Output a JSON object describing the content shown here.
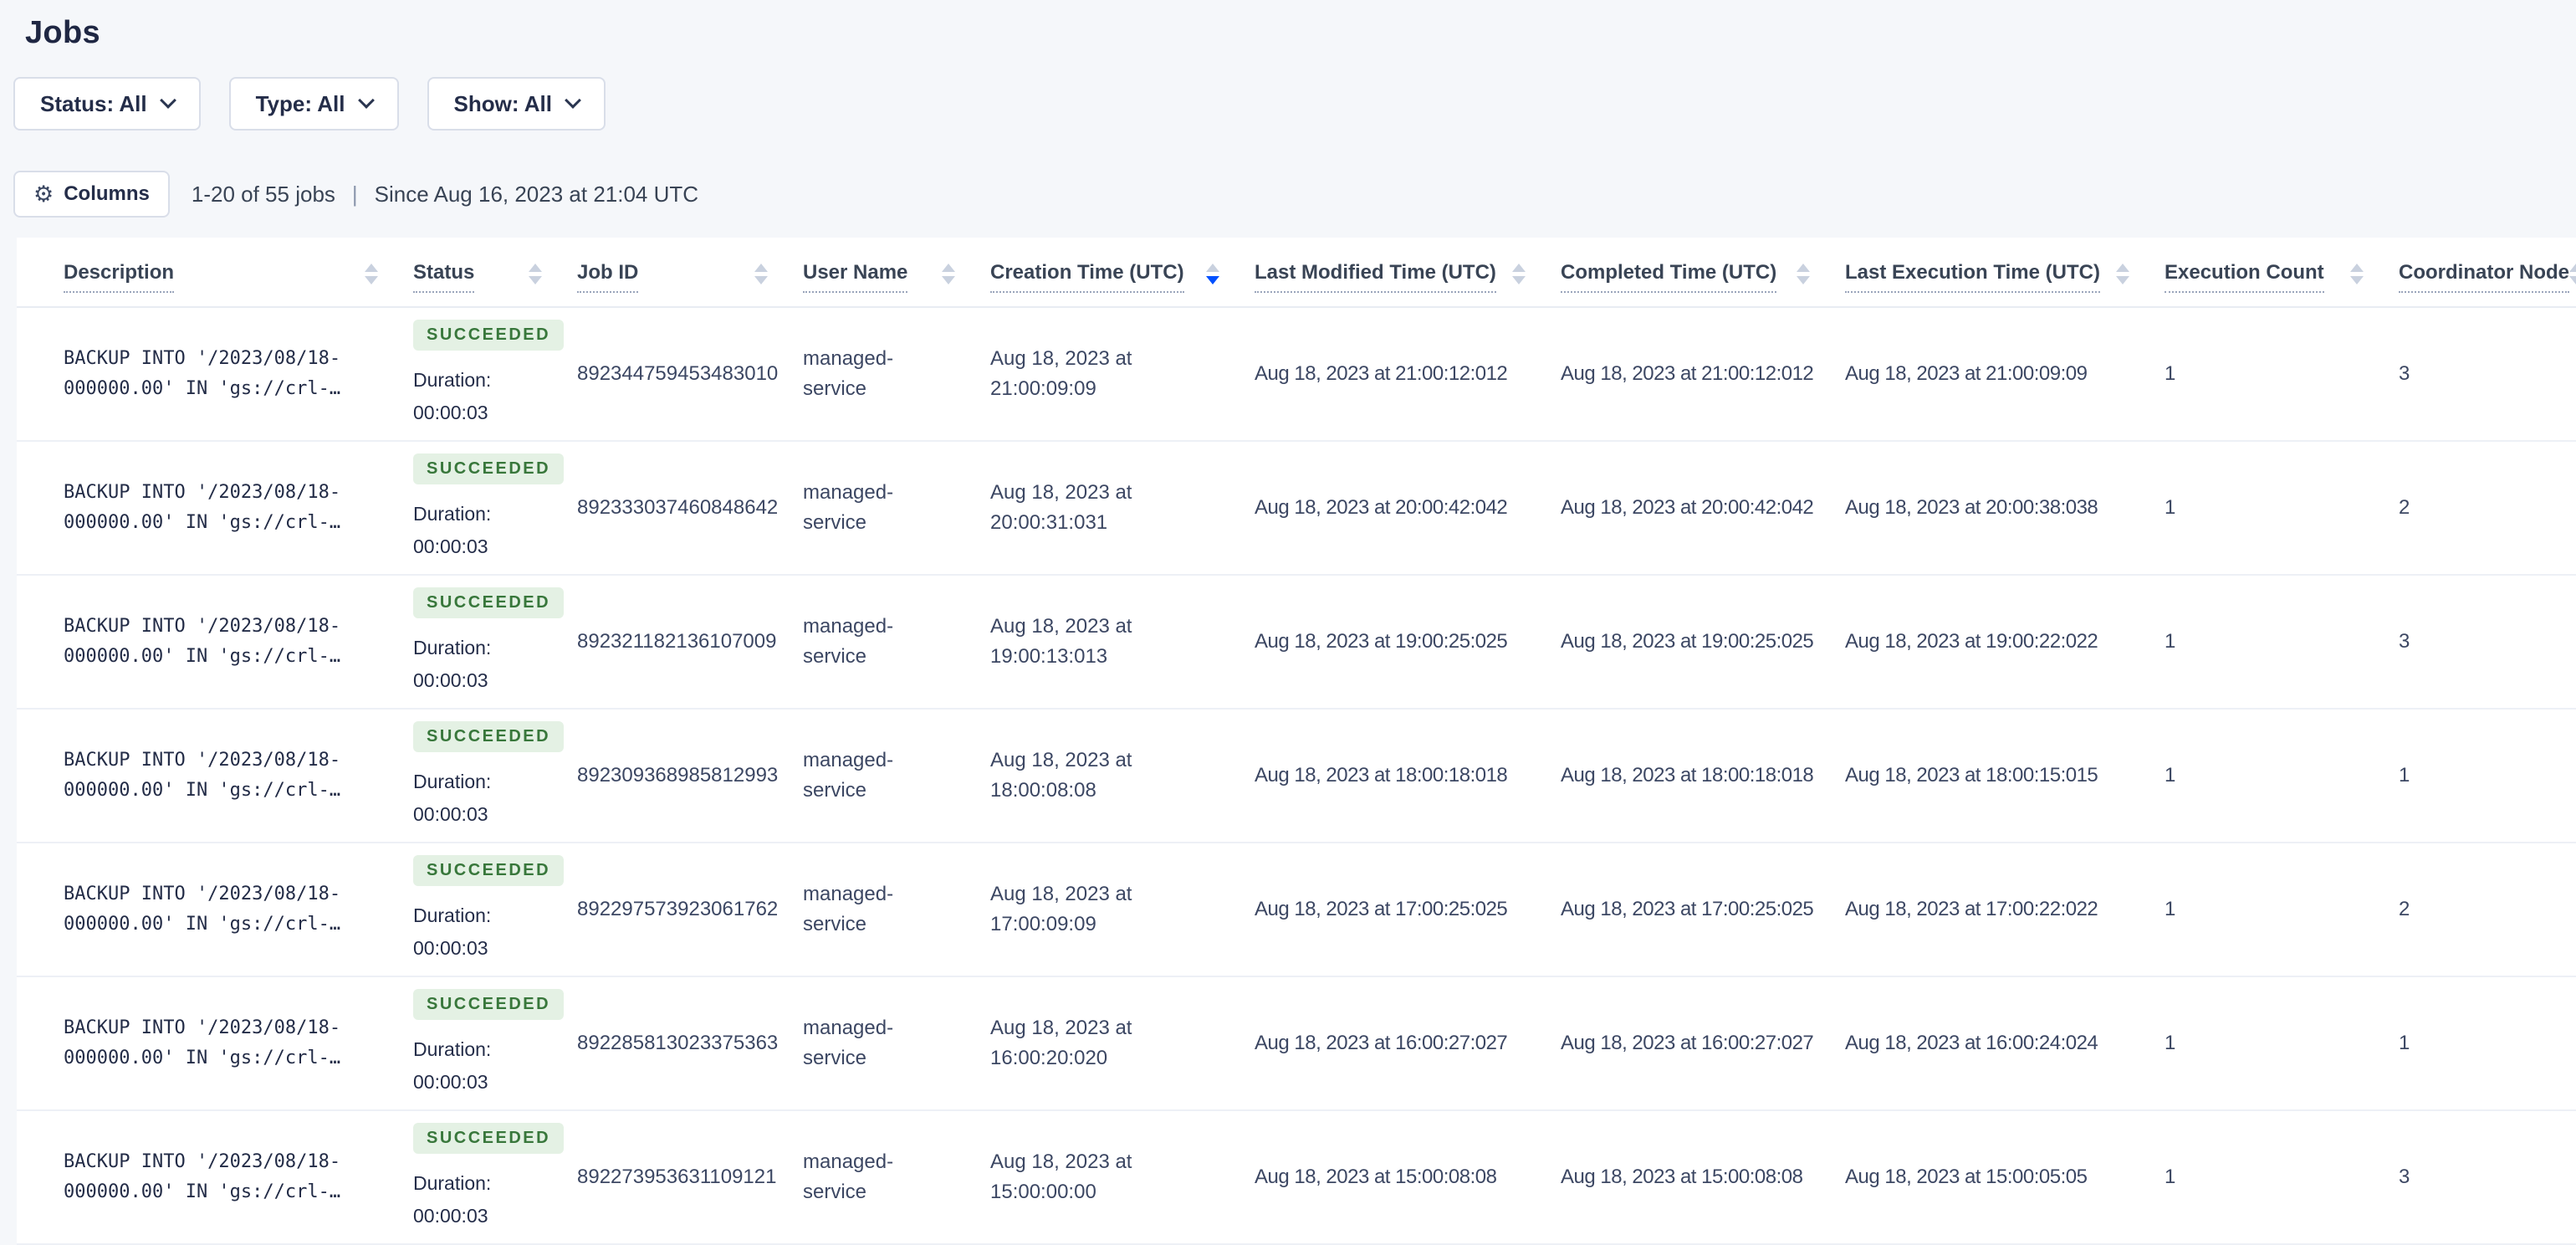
{
  "page": {
    "title": "Jobs"
  },
  "filters": [
    {
      "label": "Status: All"
    },
    {
      "label": "Type: All"
    },
    {
      "label": "Show: All"
    }
  ],
  "toolbar": {
    "columns_label": "Columns",
    "count_text": "1-20 of 55 jobs",
    "separator": "|",
    "since_text": "Since Aug 16, 2023 at 21:04 UTC"
  },
  "colors": {
    "accent_sort_active": "#0050ff",
    "badge_bg": "#e4f1e4",
    "badge_text": "#38773b",
    "page_bg": "#f5f7fa"
  },
  "table": {
    "columns": [
      {
        "label": "Description",
        "sort": "none"
      },
      {
        "label": "Status",
        "sort": "none"
      },
      {
        "label": "Job ID",
        "sort": "none"
      },
      {
        "label": "User Name",
        "sort": "none"
      },
      {
        "label": "Creation Time (UTC)",
        "sort": "desc"
      },
      {
        "label": "Last Modified Time (UTC)",
        "sort": "none"
      },
      {
        "label": "Completed Time (UTC)",
        "sort": "none"
      },
      {
        "label": "Last Execution Time (UTC)",
        "sort": "none"
      },
      {
        "label": "Execution Count",
        "sort": "none"
      },
      {
        "label": "Coordinator Node",
        "sort": "none"
      }
    ],
    "rows": [
      {
        "description_line1": "BACKUP INTO '/2023/08/18-",
        "description_line2": "000000.00' IN 'gs://crl-…",
        "status": "SUCCEEDED",
        "duration_label": "Duration:",
        "duration": "00:00:03",
        "job_id": "892344759453483010",
        "user_name": "managed-service",
        "creation_line1": "Aug 18, 2023 at",
        "creation_line2": "21:00:09:09",
        "last_modified": "Aug 18, 2023 at 21:00:12:012",
        "completed": "Aug 18, 2023 at 21:00:12:012",
        "last_execution": "Aug 18, 2023 at 21:00:09:09",
        "execution_count": "1",
        "coordinator_node": "3"
      },
      {
        "description_line1": "BACKUP INTO '/2023/08/18-",
        "description_line2": "000000.00' IN 'gs://crl-…",
        "status": "SUCCEEDED",
        "duration_label": "Duration:",
        "duration": "00:00:03",
        "job_id": "892333037460848642",
        "user_name": "managed-service",
        "creation_line1": "Aug 18, 2023 at",
        "creation_line2": "20:00:31:031",
        "last_modified": "Aug 18, 2023 at 20:00:42:042",
        "completed": "Aug 18, 2023 at 20:00:42:042",
        "last_execution": "Aug 18, 2023 at 20:00:38:038",
        "execution_count": "1",
        "coordinator_node": "2"
      },
      {
        "description_line1": "BACKUP INTO '/2023/08/18-",
        "description_line2": "000000.00' IN 'gs://crl-…",
        "status": "SUCCEEDED",
        "duration_label": "Duration:",
        "duration": "00:00:03",
        "job_id": "892321182136107009",
        "user_name": "managed-service",
        "creation_line1": "Aug 18, 2023 at",
        "creation_line2": "19:00:13:013",
        "last_modified": "Aug 18, 2023 at 19:00:25:025",
        "completed": "Aug 18, 2023 at 19:00:25:025",
        "last_execution": "Aug 18, 2023 at 19:00:22:022",
        "execution_count": "1",
        "coordinator_node": "3"
      },
      {
        "description_line1": "BACKUP INTO '/2023/08/18-",
        "description_line2": "000000.00' IN 'gs://crl-…",
        "status": "SUCCEEDED",
        "duration_label": "Duration:",
        "duration": "00:00:03",
        "job_id": "892309368985812993",
        "user_name": "managed-service",
        "creation_line1": "Aug 18, 2023 at",
        "creation_line2": "18:00:08:08",
        "last_modified": "Aug 18, 2023 at 18:00:18:018",
        "completed": "Aug 18, 2023 at 18:00:18:018",
        "last_execution": "Aug 18, 2023 at 18:00:15:015",
        "execution_count": "1",
        "coordinator_node": "1"
      },
      {
        "description_line1": "BACKUP INTO '/2023/08/18-",
        "description_line2": "000000.00' IN 'gs://crl-…",
        "status": "SUCCEEDED",
        "duration_label": "Duration:",
        "duration": "00:00:03",
        "job_id": "892297573923061762",
        "user_name": "managed-service",
        "creation_line1": "Aug 18, 2023 at",
        "creation_line2": "17:00:09:09",
        "last_modified": "Aug 18, 2023 at 17:00:25:025",
        "completed": "Aug 18, 2023 at 17:00:25:025",
        "last_execution": "Aug 18, 2023 at 17:00:22:022",
        "execution_count": "1",
        "coordinator_node": "2"
      },
      {
        "description_line1": "BACKUP INTO '/2023/08/18-",
        "description_line2": "000000.00' IN 'gs://crl-…",
        "status": "SUCCEEDED",
        "duration_label": "Duration:",
        "duration": "00:00:03",
        "job_id": "892285813023375363",
        "user_name": "managed-service",
        "creation_line1": "Aug 18, 2023 at",
        "creation_line2": "16:00:20:020",
        "last_modified": "Aug 18, 2023 at 16:00:27:027",
        "completed": "Aug 18, 2023 at 16:00:27:027",
        "last_execution": "Aug 18, 2023 at 16:00:24:024",
        "execution_count": "1",
        "coordinator_node": "1"
      },
      {
        "description_line1": "BACKUP INTO '/2023/08/18-",
        "description_line2": "000000.00' IN 'gs://crl-…",
        "status": "SUCCEEDED",
        "duration_label": "Duration:",
        "duration": "00:00:03",
        "job_id": "892273953631109121",
        "user_name": "managed-service",
        "creation_line1": "Aug 18, 2023 at",
        "creation_line2": "15:00:00:00",
        "last_modified": "Aug 18, 2023 at 15:00:08:08",
        "completed": "Aug 18, 2023 at 15:00:08:08",
        "last_execution": "Aug 18, 2023 at 15:00:05:05",
        "execution_count": "1",
        "coordinator_node": "3"
      }
    ]
  }
}
